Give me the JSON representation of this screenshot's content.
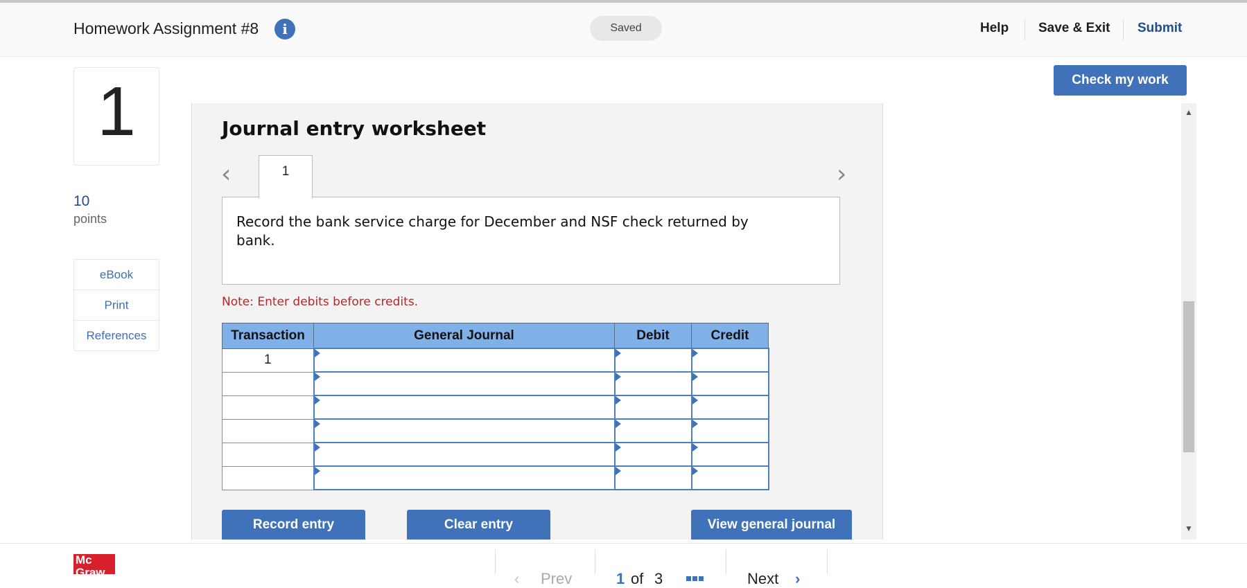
{
  "header": {
    "title": "Homework Assignment #8",
    "status": "Saved",
    "links": {
      "help": "Help",
      "save_exit": "Save & Exit",
      "submit": "Submit"
    }
  },
  "question": {
    "number": "1",
    "points": "10",
    "points_label": "points"
  },
  "sidebar": {
    "items": [
      {
        "label": "eBook"
      },
      {
        "label": "Print"
      },
      {
        "label": "References"
      }
    ]
  },
  "check_button": "Check my work",
  "worksheet": {
    "title": "Journal entry worksheet",
    "tab": "1",
    "description": "Record the bank service charge for December and NSF check returned by bank.",
    "note": "Note: Enter debits before credits.",
    "columns": [
      "Transaction",
      "General Journal",
      "Debit",
      "Credit"
    ],
    "rows": [
      {
        "transaction": "1"
      },
      {
        "transaction": ""
      },
      {
        "transaction": ""
      },
      {
        "transaction": ""
      },
      {
        "transaction": ""
      },
      {
        "transaction": ""
      }
    ],
    "buttons": {
      "record": "Record entry",
      "clear": "Clear entry",
      "view": "View general journal"
    }
  },
  "footer": {
    "logo": "Mc Graw",
    "prev": "Prev",
    "page_current": "1",
    "page_of": "of",
    "page_total": "3",
    "next": "Next"
  },
  "colors": {
    "accent": "#3f72b8",
    "table_header": "#7fb0e8",
    "note": "#b02a2a"
  }
}
